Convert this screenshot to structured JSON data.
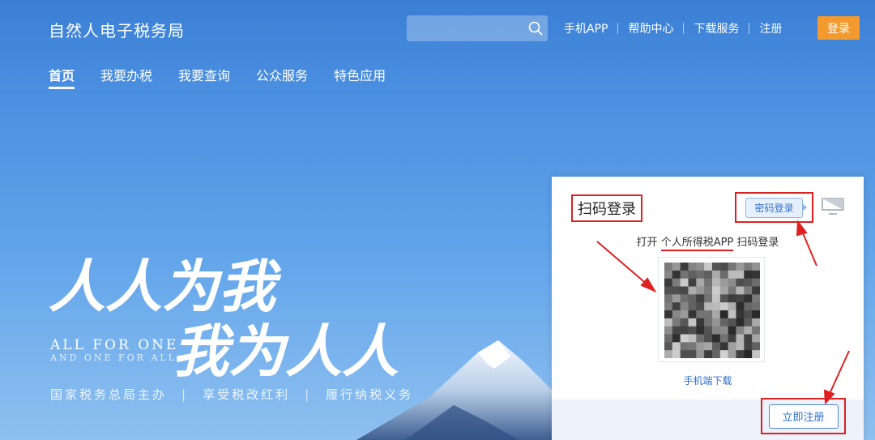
{
  "header": {
    "site_title": "自然人电子税务局",
    "search": {
      "value": "",
      "placeholder": ""
    },
    "top_links": [
      "手机APP",
      "帮助中心",
      "下载服务",
      "注册"
    ],
    "login_label": "登录",
    "tabs": [
      {
        "label": "首页",
        "active": true
      },
      {
        "label": "我要办税",
        "active": false
      },
      {
        "label": "我要查询",
        "active": false
      },
      {
        "label": "公众服务",
        "active": false
      },
      {
        "label": "特色应用",
        "active": false
      }
    ]
  },
  "hero": {
    "calligraphy_line1": "人人为我",
    "calligraphy_line2": "我为人人",
    "slogan_en_1": "ALL FOR ONE",
    "slogan_en_2": "AND ONE FOR ALL",
    "slogan_cn": [
      "国家税务总局主办",
      "享受税改红利",
      "履行纳税义务"
    ],
    "slogan_separator": "|"
  },
  "login_card": {
    "title": "扫码登录",
    "password_login_label": "密码登录",
    "instruction_prefix": "打开",
    "instruction_app": "个人所得税APP",
    "instruction_suffix": "扫码登录",
    "download_link": "手机端下载",
    "register_button": "立即注册",
    "icons": {
      "search": "search-icon",
      "pc": "computer-icon"
    }
  },
  "colors": {
    "primary_blue": "#4a8fe0",
    "login_orange": "#f29a2e",
    "annotation_red": "#e02020",
    "link_blue": "#2f6fcf"
  }
}
